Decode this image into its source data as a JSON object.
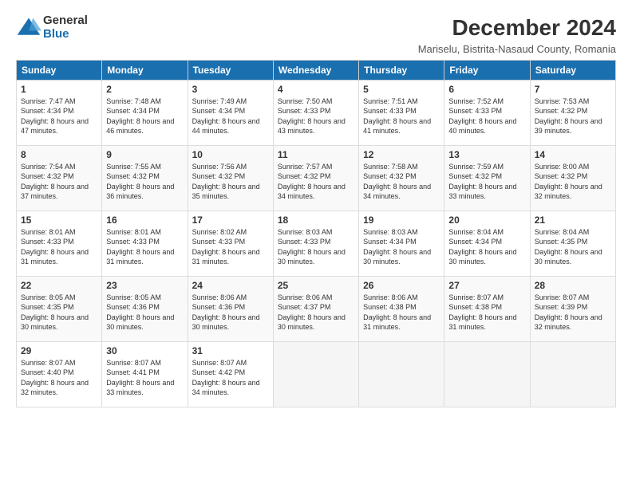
{
  "logo": {
    "general": "General",
    "blue": "Blue"
  },
  "title": "December 2024",
  "location": "Mariselu, Bistrita-Nasaud County, Romania",
  "headers": [
    "Sunday",
    "Monday",
    "Tuesday",
    "Wednesday",
    "Thursday",
    "Friday",
    "Saturday"
  ],
  "weeks": [
    [
      {
        "day": "1",
        "sunrise": "7:47 AM",
        "sunset": "4:34 PM",
        "daylight": "8 hours and 47 minutes."
      },
      {
        "day": "2",
        "sunrise": "7:48 AM",
        "sunset": "4:34 PM",
        "daylight": "8 hours and 46 minutes."
      },
      {
        "day": "3",
        "sunrise": "7:49 AM",
        "sunset": "4:34 PM",
        "daylight": "8 hours and 44 minutes."
      },
      {
        "day": "4",
        "sunrise": "7:50 AM",
        "sunset": "4:33 PM",
        "daylight": "8 hours and 43 minutes."
      },
      {
        "day": "5",
        "sunrise": "7:51 AM",
        "sunset": "4:33 PM",
        "daylight": "8 hours and 41 minutes."
      },
      {
        "day": "6",
        "sunrise": "7:52 AM",
        "sunset": "4:33 PM",
        "daylight": "8 hours and 40 minutes."
      },
      {
        "day": "7",
        "sunrise": "7:53 AM",
        "sunset": "4:32 PM",
        "daylight": "8 hours and 39 minutes."
      }
    ],
    [
      {
        "day": "8",
        "sunrise": "7:54 AM",
        "sunset": "4:32 PM",
        "daylight": "8 hours and 37 minutes."
      },
      {
        "day": "9",
        "sunrise": "7:55 AM",
        "sunset": "4:32 PM",
        "daylight": "8 hours and 36 minutes."
      },
      {
        "day": "10",
        "sunrise": "7:56 AM",
        "sunset": "4:32 PM",
        "daylight": "8 hours and 35 minutes."
      },
      {
        "day": "11",
        "sunrise": "7:57 AM",
        "sunset": "4:32 PM",
        "daylight": "8 hours and 34 minutes."
      },
      {
        "day": "12",
        "sunrise": "7:58 AM",
        "sunset": "4:32 PM",
        "daylight": "8 hours and 34 minutes."
      },
      {
        "day": "13",
        "sunrise": "7:59 AM",
        "sunset": "4:32 PM",
        "daylight": "8 hours and 33 minutes."
      },
      {
        "day": "14",
        "sunrise": "8:00 AM",
        "sunset": "4:32 PM",
        "daylight": "8 hours and 32 minutes."
      }
    ],
    [
      {
        "day": "15",
        "sunrise": "8:01 AM",
        "sunset": "4:33 PM",
        "daylight": "8 hours and 31 minutes."
      },
      {
        "day": "16",
        "sunrise": "8:01 AM",
        "sunset": "4:33 PM",
        "daylight": "8 hours and 31 minutes."
      },
      {
        "day": "17",
        "sunrise": "8:02 AM",
        "sunset": "4:33 PM",
        "daylight": "8 hours and 31 minutes."
      },
      {
        "day": "18",
        "sunrise": "8:03 AM",
        "sunset": "4:33 PM",
        "daylight": "8 hours and 30 minutes."
      },
      {
        "day": "19",
        "sunrise": "8:03 AM",
        "sunset": "4:34 PM",
        "daylight": "8 hours and 30 minutes."
      },
      {
        "day": "20",
        "sunrise": "8:04 AM",
        "sunset": "4:34 PM",
        "daylight": "8 hours and 30 minutes."
      },
      {
        "day": "21",
        "sunrise": "8:04 AM",
        "sunset": "4:35 PM",
        "daylight": "8 hours and 30 minutes."
      }
    ],
    [
      {
        "day": "22",
        "sunrise": "8:05 AM",
        "sunset": "4:35 PM",
        "daylight": "8 hours and 30 minutes."
      },
      {
        "day": "23",
        "sunrise": "8:05 AM",
        "sunset": "4:36 PM",
        "daylight": "8 hours and 30 minutes."
      },
      {
        "day": "24",
        "sunrise": "8:06 AM",
        "sunset": "4:36 PM",
        "daylight": "8 hours and 30 minutes."
      },
      {
        "day": "25",
        "sunrise": "8:06 AM",
        "sunset": "4:37 PM",
        "daylight": "8 hours and 30 minutes."
      },
      {
        "day": "26",
        "sunrise": "8:06 AM",
        "sunset": "4:38 PM",
        "daylight": "8 hours and 31 minutes."
      },
      {
        "day": "27",
        "sunrise": "8:07 AM",
        "sunset": "4:38 PM",
        "daylight": "8 hours and 31 minutes."
      },
      {
        "day": "28",
        "sunrise": "8:07 AM",
        "sunset": "4:39 PM",
        "daylight": "8 hours and 32 minutes."
      }
    ],
    [
      {
        "day": "29",
        "sunrise": "8:07 AM",
        "sunset": "4:40 PM",
        "daylight": "8 hours and 32 minutes."
      },
      {
        "day": "30",
        "sunrise": "8:07 AM",
        "sunset": "4:41 PM",
        "daylight": "8 hours and 33 minutes."
      },
      {
        "day": "31",
        "sunrise": "8:07 AM",
        "sunset": "4:42 PM",
        "daylight": "8 hours and 34 minutes."
      },
      null,
      null,
      null,
      null
    ]
  ]
}
